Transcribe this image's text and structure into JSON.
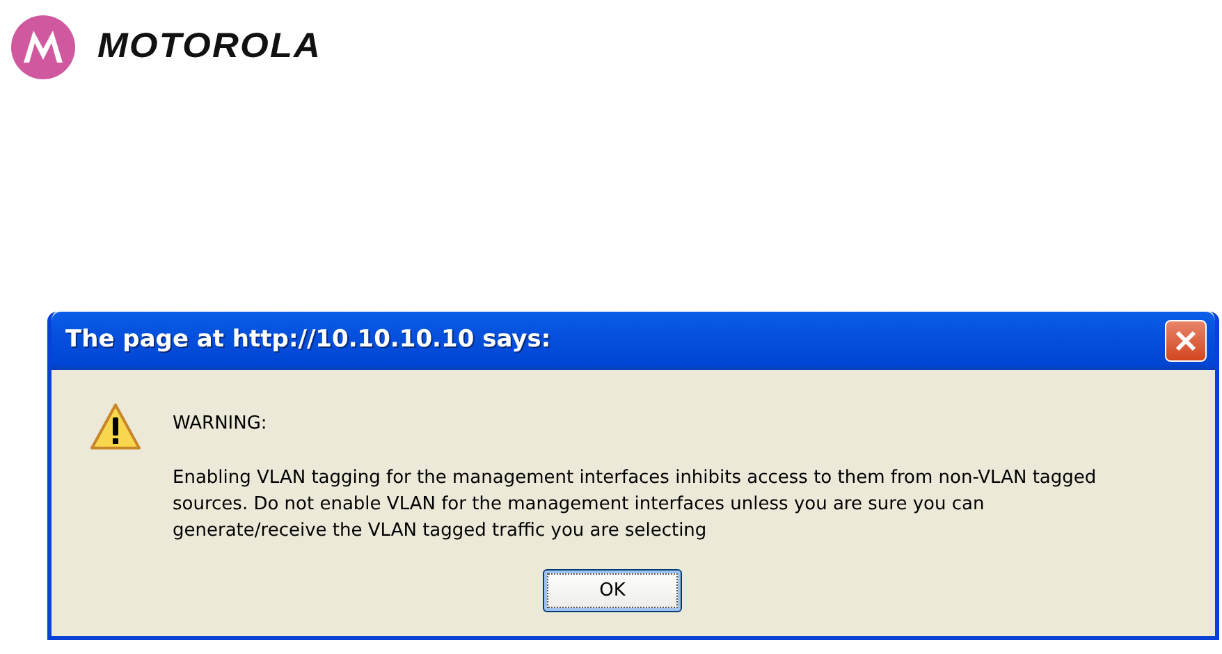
{
  "header": {
    "logo_text": "MOTOROLA"
  },
  "dialog": {
    "title": "The page at http://10.10.10.10 says:",
    "heading": "WARNING:",
    "message_lines": [
      "Enabling VLAN tagging for the management interfaces inhibits access to them from non-VLAN tagged",
      "sources. Do not enable VLAN for the management interfaces unless you are sure you can",
      "generate/receive the VLAN tagged traffic you are selecting"
    ],
    "buttons": [
      "OK"
    ]
  }
}
